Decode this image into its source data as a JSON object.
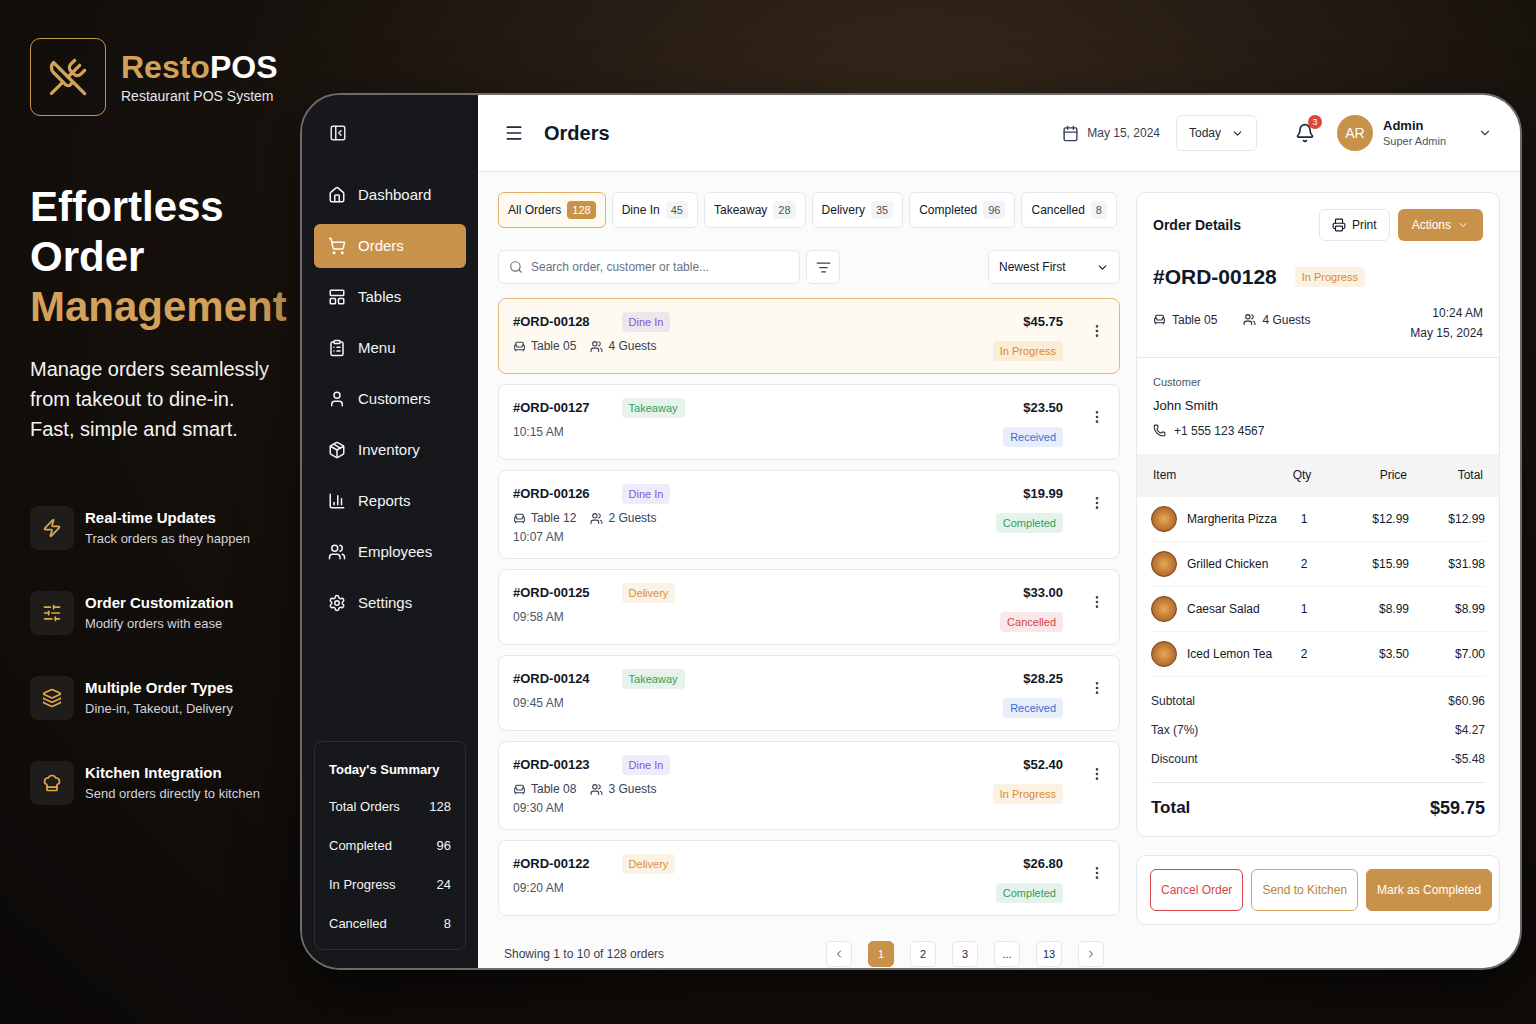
{
  "brand": {
    "name_main": "Resto",
    "name_accent": "POS",
    "tagline": "Restaurant POS System"
  },
  "hero": {
    "title_lines": [
      "Effortless",
      "Order"
    ],
    "title_accent": "Management",
    "description_lines": [
      "Manage orders seamlessly",
      "from takeout to dine-in.",
      "Fast, simple and smart."
    ]
  },
  "features": [
    {
      "title": "Real-time Updates",
      "subtitle": "Track orders as they happen"
    },
    {
      "title": "Order Customization",
      "subtitle": "Modify orders with ease"
    },
    {
      "title": "Multiple Order Types",
      "subtitle": "Dine-in, Takeout, Delivery"
    },
    {
      "title": "Kitchen Integration",
      "subtitle": "Send orders directly to kitchen"
    }
  ],
  "sidebar": {
    "items": [
      {
        "label": "Dashboard",
        "selected": false
      },
      {
        "label": "Orders",
        "selected": true
      },
      {
        "label": "Tables",
        "selected": false
      },
      {
        "label": "Menu",
        "selected": false
      },
      {
        "label": "Customers",
        "selected": false
      },
      {
        "label": "Inventory",
        "selected": false
      },
      {
        "label": "Reports",
        "selected": false
      },
      {
        "label": "Employees",
        "selected": false
      },
      {
        "label": "Settings",
        "selected": false
      }
    ],
    "summary": {
      "title": "Today's Summary",
      "rows": [
        {
          "label": "Total Orders",
          "value": "128"
        },
        {
          "label": "Completed",
          "value": "96"
        },
        {
          "label": "In Progress",
          "value": "24"
        },
        {
          "label": "Cancelled",
          "value": "8"
        }
      ]
    }
  },
  "header": {
    "title": "Orders",
    "date": "May 15, 2024",
    "range": "Today",
    "notifications": "3",
    "user": {
      "initials": "AR",
      "name": "Admin",
      "role": "Super Admin"
    }
  },
  "filters": [
    {
      "label": "All Orders",
      "count": "128",
      "selected": true
    },
    {
      "label": "Dine In",
      "count": "45",
      "selected": false
    },
    {
      "label": "Takeaway",
      "count": "28",
      "selected": false
    },
    {
      "label": "Delivery",
      "count": "35",
      "selected": false
    },
    {
      "label": "Completed",
      "count": "96",
      "selected": false
    },
    {
      "label": "Cancelled",
      "count": "8",
      "selected": false
    }
  ],
  "search": {
    "placeholder": "Search order, customer or table..."
  },
  "sort": {
    "label": "Newest First"
  },
  "orders": [
    {
      "id": "#ORD-00128",
      "type": {
        "label": "Dine In",
        "color": "#7c5cd6"
      },
      "table": "Table 05",
      "guests": "4 Guests",
      "price": "$45.75",
      "status": {
        "label": "In Progress",
        "color": "#e08a1e"
      },
      "selected": true
    },
    {
      "id": "#ORD-00127",
      "type": {
        "label": "Takeaway",
        "color": "#2f9e5b"
      },
      "time": "10:15 AM",
      "price": "$23.50",
      "status": {
        "label": "Received",
        "color": "#3b6fd6"
      },
      "selected": false
    },
    {
      "id": "#ORD-00126",
      "type": {
        "label": "Dine In",
        "color": "#7c5cd6"
      },
      "table": "Table 12",
      "guests": "2 Guests",
      "time": "10:07 AM",
      "price": "$19.99",
      "status": {
        "label": "Completed",
        "color": "#2f9e5b"
      },
      "selected": false
    },
    {
      "id": "#ORD-00125",
      "type": {
        "label": "Delivery",
        "color": "#e0902f"
      },
      "time": "09:58 AM",
      "price": "$33.00",
      "status": {
        "label": "Cancelled",
        "color": "#d64545"
      },
      "selected": false
    },
    {
      "id": "#ORD-00124",
      "type": {
        "label": "Takeaway",
        "color": "#2f9e5b"
      },
      "time": "09:45 AM",
      "price": "$28.25",
      "status": {
        "label": "Received",
        "color": "#3b6fd6"
      },
      "selected": false
    },
    {
      "id": "#ORD-00123",
      "type": {
        "label": "Dine In",
        "color": "#7c5cd6"
      },
      "table": "Table 08",
      "guests": "3 Guests",
      "time": "09:30 AM",
      "price": "$52.40",
      "status": {
        "label": "In Progress",
        "color": "#e08a1e"
      },
      "selected": false
    },
    {
      "id": "#ORD-00122",
      "type": {
        "label": "Delivery",
        "color": "#e0902f"
      },
      "time": "09:20 AM",
      "price": "$26.80",
      "status": {
        "label": "Completed",
        "color": "#2f9e5b"
      },
      "selected": false
    }
  ],
  "pagination": {
    "summary": "Showing 1 to 10 of 128 orders",
    "pages": [
      {
        "label": "1",
        "selected": true
      },
      {
        "label": "2",
        "selected": false
      },
      {
        "label": "3",
        "selected": false
      },
      {
        "label": "...",
        "selected": false
      },
      {
        "label": "13",
        "selected": false
      }
    ]
  },
  "details": {
    "title": "Order Details",
    "print": "Print",
    "actions": "Actions",
    "id": "#ORD-00128",
    "status": {
      "label": "In Progress",
      "color": "#e08a1e"
    },
    "table": "Table 05",
    "guests": "4 Guests",
    "time": "10:24 AM",
    "date": "May 15, 2024",
    "customer": {
      "label": "Customer",
      "name": "John Smith",
      "phone": "+1 555 123 4567"
    },
    "columns": [
      "Item",
      "Qty",
      "Price",
      "Total"
    ],
    "items": [
      {
        "name": "Margherita Pizza",
        "qty": "1",
        "price": "$12.99",
        "total": "$12.99"
      },
      {
        "name": "Grilled Chicken",
        "qty": "2",
        "price": "$15.99",
        "total": "$31.98"
      },
      {
        "name": "Caesar Salad",
        "qty": "1",
        "price": "$8.99",
        "total": "$8.99"
      },
      {
        "name": "Iced Lemon Tea",
        "qty": "2",
        "price": "$3.50",
        "total": "$7.00"
      }
    ],
    "summary": [
      {
        "label": "Subtotal",
        "value": "$60.96"
      },
      {
        "label": "Tax (7%)",
        "value": "$4.27"
      },
      {
        "label": "Discount",
        "value": "-$5.48"
      }
    ],
    "total": {
      "label": "Total",
      "value": "$59.75"
    },
    "buttons": [
      {
        "label": "Cancel Order",
        "kind": "danger"
      },
      {
        "label": "Send to Kitchen",
        "kind": "outline"
      },
      {
        "label": "Mark as Completed",
        "kind": "primary"
      }
    ]
  }
}
